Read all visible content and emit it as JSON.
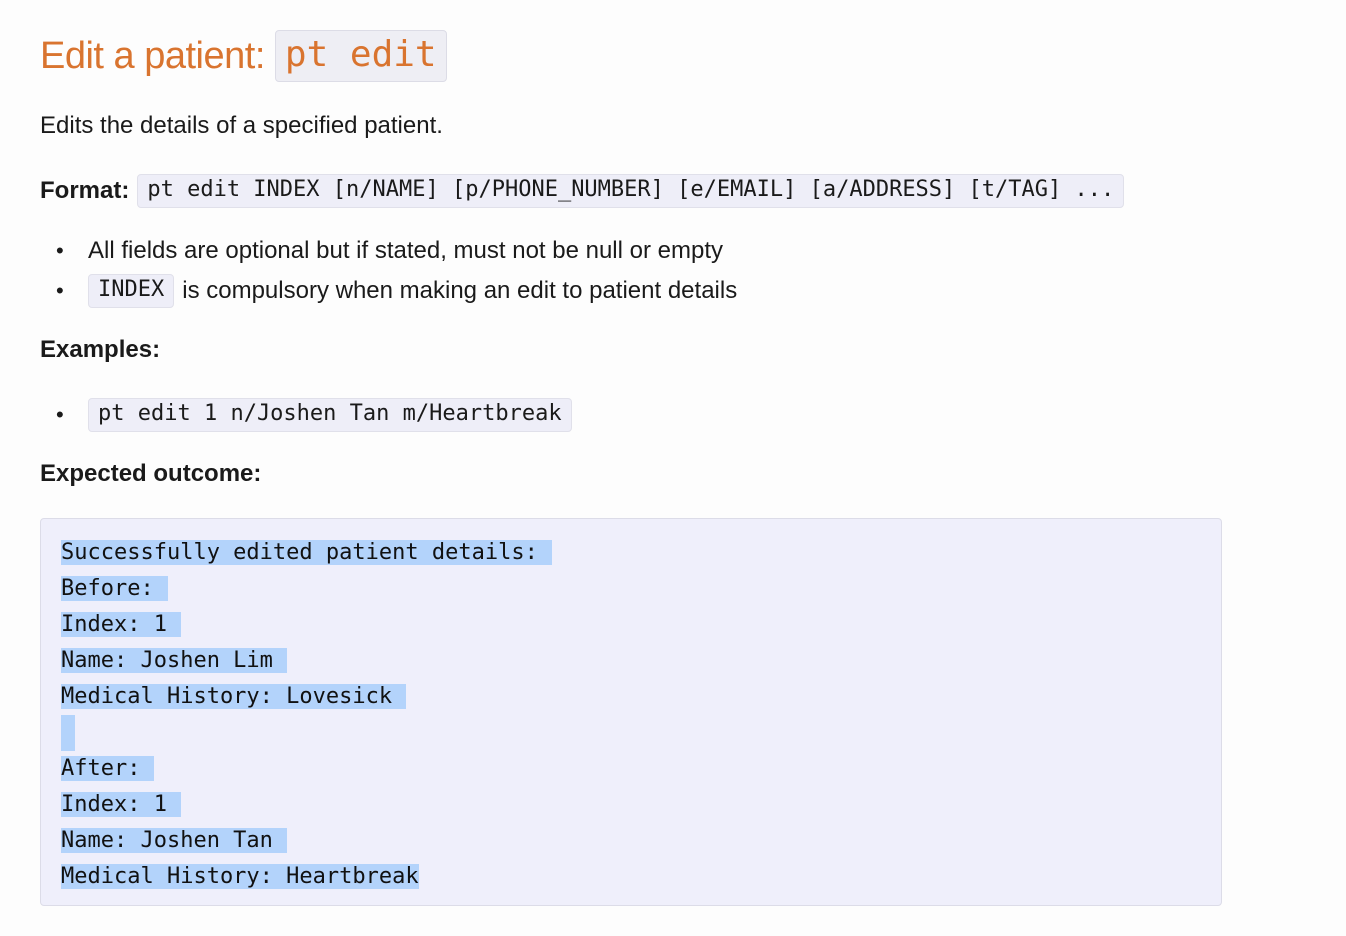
{
  "heading": {
    "text": "Edit a patient:",
    "command": "pt edit"
  },
  "description": "Edits the details of a specified patient.",
  "format": {
    "label": "Format:",
    "syntax": "pt edit INDEX [n/NAME] [p/PHONE_NUMBER] [e/EMAIL] [a/ADDRESS] [t/TAG] ..."
  },
  "notes": [
    {
      "text": "All fields are optional but if stated, must not be null or empty"
    },
    {
      "code": "INDEX",
      "text": "is compulsory when making an edit to patient details"
    }
  ],
  "examples": {
    "label": "Examples:",
    "items": [
      "pt edit 1 n/Joshen Tan m/Heartbreak"
    ]
  },
  "expected_outcome": {
    "label": "Expected outcome:",
    "lines": [
      "Successfully edited patient details:",
      "Before:",
      "Index: 1",
      "Name: Joshen Lim",
      "Medical History: Lovesick",
      "",
      "After:",
      "Index: 1",
      "Name: Joshen Tan",
      "Medical History: Heartbreak"
    ]
  }
}
